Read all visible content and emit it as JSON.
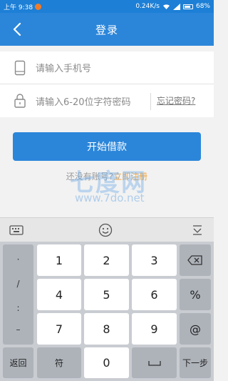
{
  "status_bar": {
    "time": "上午 9:38",
    "speed": "0.24K/s",
    "battery": "68%"
  },
  "nav": {
    "title": "登录"
  },
  "form": {
    "phone_placeholder": "请输入手机号",
    "password_placeholder": "请输入6-20位字符密码",
    "forgot_label": "忘记密码?"
  },
  "actions": {
    "submit_label": "开始借款",
    "register_prompt": "还没有账号?",
    "register_link": "立即注册"
  },
  "watermark": {
    "logo_text": "七度网",
    "url": "www.7do.net"
  },
  "keyboard": {
    "symbols": [
      "·",
      "/",
      ":",
      "–"
    ],
    "rows": [
      [
        "1",
        "2",
        "3"
      ],
      [
        "4",
        "5",
        "6"
      ],
      [
        "7",
        "8",
        "9"
      ]
    ],
    "right_keys": [
      "%",
      "@"
    ],
    "bottom": {
      "back": "返回",
      "sym": "符",
      "zero": "0",
      "next": "下一步"
    }
  },
  "colors": {
    "primary": "#2b86da",
    "statusbar": "#1d7fd6",
    "link": "#f0a540"
  }
}
